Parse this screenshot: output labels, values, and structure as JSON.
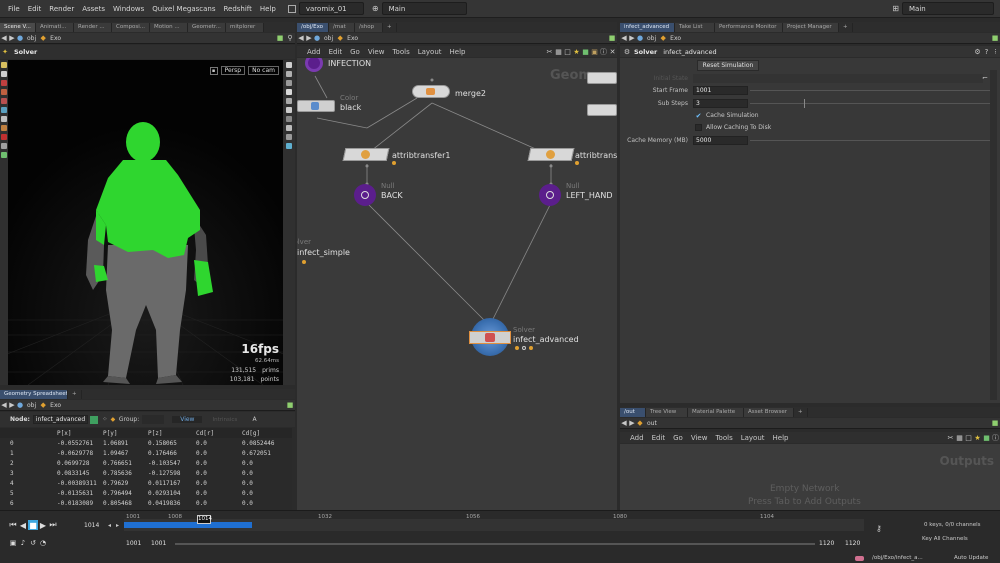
{
  "menubar": {
    "items": [
      "File",
      "Edit",
      "Render",
      "Assets",
      "Windows",
      "Quixel Megascans",
      "Redshift",
      "Help"
    ],
    "scene_file": "varomix_01",
    "desktop": "Main",
    "right_desktop": "Main"
  },
  "viewport_pane": {
    "tabs": [
      "Scene V...",
      "Animati...",
      "Render ...",
      "Composi...",
      "Motion ...",
      "Geometr...",
      "mitplorer"
    ],
    "path": [
      "obj",
      "Exo"
    ],
    "title": "Solver",
    "camera_menu": "Persp",
    "cam_menu": "No cam",
    "fps": "16fps",
    "ms": "62.64ms",
    "prims_count": "131,515",
    "prims_label": "prims",
    "points_count": "103,181",
    "points_label": "points"
  },
  "spreadsheet": {
    "tabs": [
      "Geometry Spreadsheet",
      "+"
    ],
    "path": [
      "obj",
      "Exo"
    ],
    "node_label": "Node:",
    "node_value": "infect_advanced",
    "group_label": "Group:",
    "view_label": "View",
    "intrinsics_label": "Intrinsics",
    "columns": [
      "",
      "P[x]",
      "P[y]",
      "P[z]",
      "Cd[r]",
      "Cd[g]"
    ],
    "rows": [
      [
        "0",
        "-0.0552761",
        "1.06891",
        "0.158065",
        "0.0",
        "0.0852446"
      ],
      [
        "1",
        "-0.0629778",
        "1.09467",
        "0.176466",
        "0.0",
        "0.672051"
      ],
      [
        "2",
        "0.0699728",
        "0.766651",
        "-0.103547",
        "0.0",
        "0.0"
      ],
      [
        "3",
        "0.0833145",
        "0.785636",
        "-0.127598",
        "0.0",
        "0.0"
      ],
      [
        "4",
        "-0.00389311",
        "0.79629",
        "0.0117167",
        "0.0",
        "0.0"
      ],
      [
        "5",
        "-0.0135631",
        "0.796494",
        "0.0293104",
        "0.0",
        "0.0"
      ],
      [
        "6",
        "-0.0183089",
        "0.805468",
        "0.0419836",
        "0.0",
        "0.0"
      ]
    ]
  },
  "network_pane": {
    "tabs": [
      "/obj/Exo",
      "/mat",
      "/shop",
      "+"
    ],
    "path": [
      "obj",
      "Exo"
    ],
    "menu": [
      "Add",
      "Edit",
      "Go",
      "View",
      "Tools",
      "Layout",
      "Help"
    ],
    "watermark": "Geom",
    "nodes": {
      "infection": {
        "label": "INFECTION"
      },
      "black": {
        "type": "Color",
        "label": "black"
      },
      "merge2": {
        "label": "merge2"
      },
      "attribtransfer1": {
        "label": "attribtransfer1"
      },
      "attribtrans_right": {
        "label": "attribtrans"
      },
      "back": {
        "type": "Null",
        "label": "BACK"
      },
      "left_hand": {
        "type": "Null",
        "label": "LEFT_HAND"
      },
      "infect_simple": {
        "type": "Solver",
        "label": "infect_simple"
      },
      "infect_advanced": {
        "type": "Solver",
        "label": "infect_advanced"
      }
    }
  },
  "params_pane": {
    "tabs": [
      "infect_advanced",
      "Take List",
      "Performance Monitor",
      "Project Manager",
      "+"
    ],
    "node_type": "Solver",
    "node_name": "infect_advanced",
    "reset_button": "Reset Simulation",
    "initial_state_label": "Initial State",
    "start_frame_label": "Start Frame",
    "start_frame": "1001",
    "sub_steps_label": "Sub Steps",
    "sub_steps": "3",
    "cache_sim_label": "Cache Simulation",
    "allow_disk_label": "Allow Caching To Disk",
    "cache_memory_label": "Cache Memory (MB)",
    "cache_memory": "5000"
  },
  "outputs_pane": {
    "tabs": [
      "/out",
      "Tree View",
      "Material Palette",
      "Asset Browser",
      "+"
    ],
    "path": "out",
    "menu": [
      "Add",
      "Edit",
      "Go",
      "View",
      "Tools",
      "Layout",
      "Help"
    ],
    "watermark": "Outputs",
    "empty_line1": "Empty Network",
    "empty_line2": "Press Tab to Add Outputs"
  },
  "timeline": {
    "current_frame": "1014",
    "current_frame_marker": "1014",
    "ticks": [
      "1001",
      "1008",
      "1032",
      "1056",
      "1080",
      "1104"
    ],
    "start_frame": "1001",
    "range_start": "1001",
    "range_end": "1120",
    "end_frame": "1120",
    "keys_info": "0 keys, 0/0 channels",
    "key_all": "Key All Channels",
    "status_path": "/obj/Exo/infect_a...",
    "auto_update": "Auto Update",
    "playhead_fraction": 0.108
  },
  "colors": {
    "infect_green": "#2fd62f",
    "null_purple": "#5b1e8c",
    "selection_blue": "#3a6fb0",
    "timeline_blue": "#1f6fd1"
  }
}
